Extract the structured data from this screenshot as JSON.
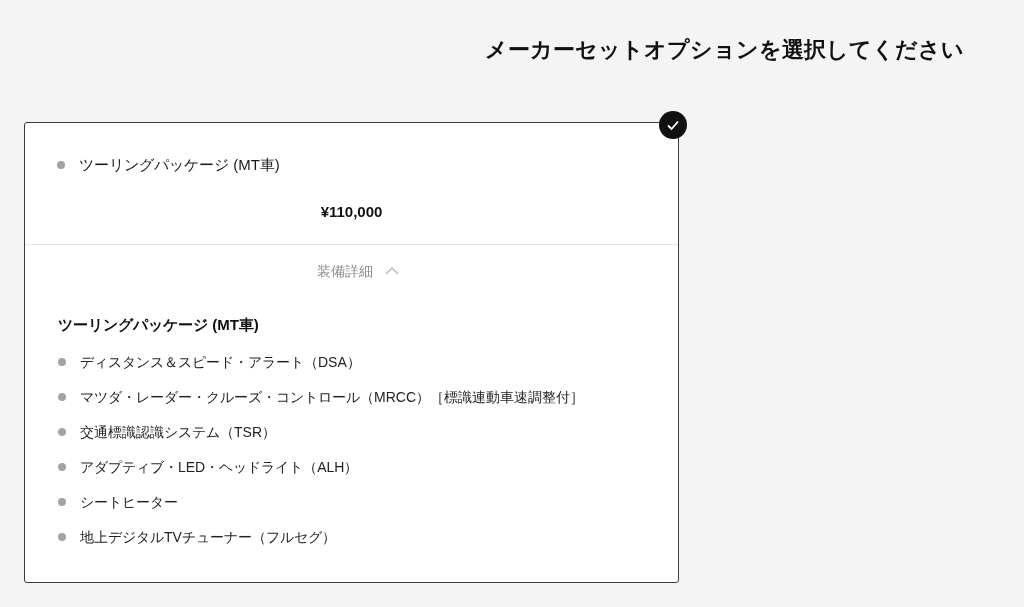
{
  "heading": "メーカーセットオプションを選択してください",
  "option_card": {
    "selected": true,
    "package_name": "ツーリングパッケージ (MT車)",
    "price": "¥110,000",
    "details_toggle": {
      "label": "装備詳細",
      "expanded": true
    },
    "details": {
      "title": "ツーリングパッケージ (MT車)",
      "items": [
        "ディスタンス＆スピード・アラート（DSA）",
        "マツダ・レーダー・クルーズ・コントロール（MRCC）［標識連動車速調整付］",
        "交通標識認識システム（TSR）",
        "アダプティブ・LED・ヘッドライト（ALH）",
        "シートヒーター",
        "地上デジタルTVチューナー（フルセグ）"
      ]
    }
  }
}
